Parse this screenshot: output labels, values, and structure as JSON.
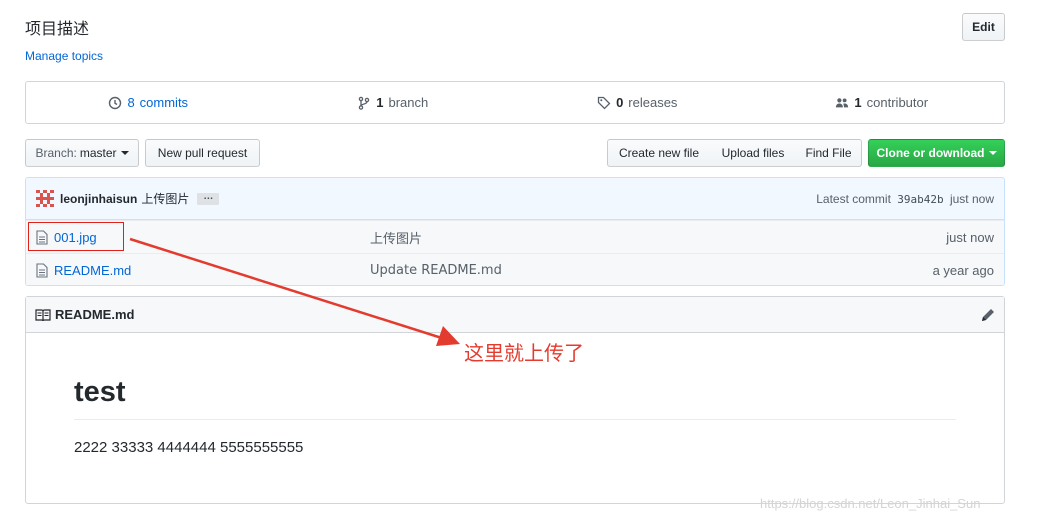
{
  "header": {
    "title": "项目描述",
    "manage_topics": "Manage topics",
    "edit_label": "Edit"
  },
  "numbers": {
    "commits_count": "8",
    "commits_label": "commits",
    "branch_count": "1",
    "branch_label": "branch",
    "releases_count": "0",
    "releases_label": "releases",
    "contributor_count": "1",
    "contributor_label": "contributor"
  },
  "toolbar": {
    "branch_prefix": "Branch:",
    "branch_name": "master",
    "new_pr": "New pull request",
    "create_file": "Create new file",
    "upload_files": "Upload files",
    "find_file": "Find File",
    "clone": "Clone or download"
  },
  "commit": {
    "author": "leonjinhaisun",
    "message": "上传图片",
    "ellipsis": "…",
    "latest_label": "Latest commit",
    "sha": "39ab42b",
    "when": "just now"
  },
  "files": [
    {
      "name": "001.jpg",
      "message": "上传图片",
      "age": "just now"
    },
    {
      "name": "README.md",
      "message": "Update README.md",
      "age": "a year ago"
    }
  ],
  "readme": {
    "filename": "README.md",
    "heading": "test",
    "body": "2222 33333 4444444 5555555555"
  },
  "annotation": {
    "text": "这里就上传了",
    "color": "#e43b2f"
  },
  "watermark": "https://blog.csdn.net/Leon_Jinhai_Sun",
  "colors": {
    "link": "#0366d6",
    "clone_green": "#28a745",
    "commit_bg": "#f1f8ff"
  }
}
